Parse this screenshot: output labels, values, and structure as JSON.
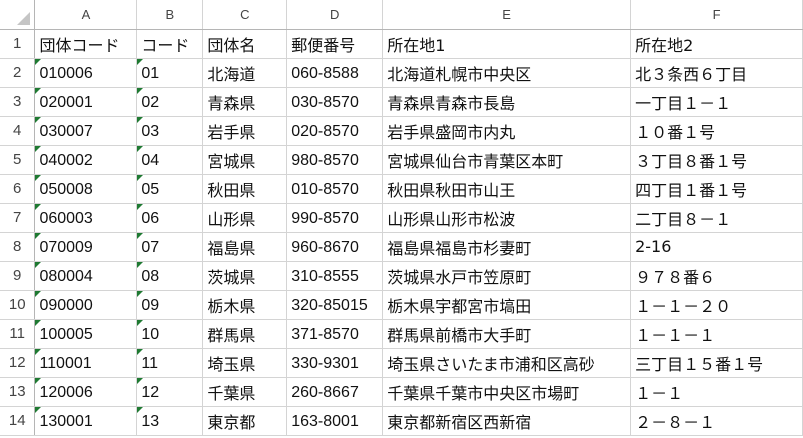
{
  "columns": [
    "A",
    "B",
    "C",
    "D",
    "E",
    "F"
  ],
  "row_numbers": [
    "1",
    "2",
    "3",
    "4",
    "5",
    "6",
    "7",
    "8",
    "9",
    "10",
    "11",
    "12",
    "13",
    "14"
  ],
  "header": [
    "団体コード",
    "コード",
    "団体名",
    "郵便番号",
    "所在地1",
    "所在地2"
  ],
  "rows": [
    [
      "010006",
      "01",
      "北海道",
      "060-8588",
      "北海道札幌市中央区",
      "北３条西６丁目"
    ],
    [
      "020001",
      "02",
      "青森県",
      "030-8570",
      "青森県青森市長島",
      "一丁目１－１"
    ],
    [
      "030007",
      "03",
      "岩手県",
      "020-8570",
      "岩手県盛岡市内丸",
      "１０番１号"
    ],
    [
      "040002",
      "04",
      "宮城県",
      "980-8570",
      "宮城県仙台市青葉区本町",
      "３丁目８番１号"
    ],
    [
      "050008",
      "05",
      "秋田県",
      "010-8570",
      "秋田県秋田市山王",
      "四丁目１番１号"
    ],
    [
      "060003",
      "06",
      "山形県",
      "990-8570",
      "山形県山形市松波",
      "二丁目８－１"
    ],
    [
      "070009",
      "07",
      "福島県",
      "960-8670",
      "福島県福島市杉妻町",
      "2-16"
    ],
    [
      "080004",
      "08",
      "茨城県",
      "310-8555",
      "茨城県水戸市笠原町",
      "９７８番６"
    ],
    [
      "090000",
      "09",
      "栃木県",
      "320-85015",
      "栃木県宇都宮市塙田",
      "１－１－２０"
    ],
    [
      "100005",
      "10",
      "群馬県",
      "371-8570",
      "群馬県前橋市大手町",
      "１－１－１"
    ],
    [
      "110001",
      "11",
      "埼玉県",
      "330-9301",
      "埼玉県さいたま市浦和区高砂",
      "三丁目１５番１号"
    ],
    [
      "120006",
      "12",
      "千葉県",
      "260-8667",
      "千葉県千葉市中央区市場町",
      "１－１"
    ],
    [
      "130001",
      "13",
      "東京都",
      "163-8001",
      "東京都新宿区西新宿",
      "２－８－１"
    ]
  ],
  "text_number_columns": [
    0,
    1
  ],
  "colors": {
    "grid": "#d4d4d4",
    "header_text": "#444444",
    "error_flag": "#1f7a32"
  }
}
